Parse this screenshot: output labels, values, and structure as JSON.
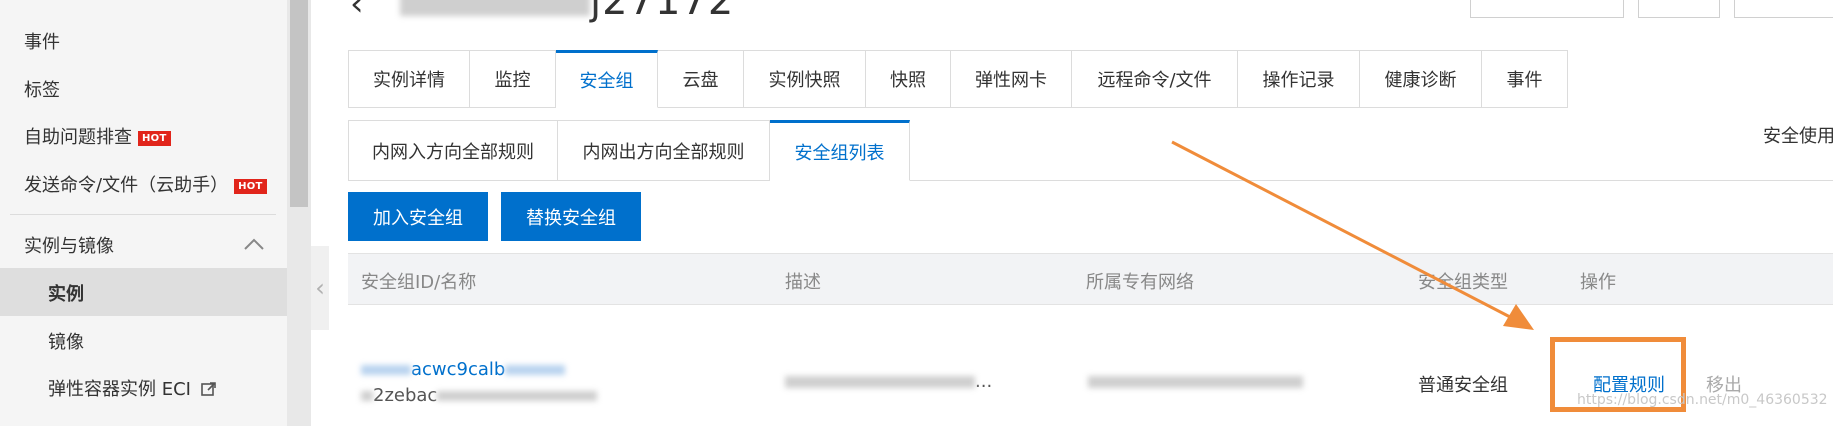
{
  "sidebar": {
    "items": [
      {
        "label": "事件"
      },
      {
        "label": "标签"
      },
      {
        "label": "自助问题排查",
        "badge": "HOT"
      },
      {
        "label": "发送命令/文件（云助手）",
        "badge": "HOT"
      }
    ],
    "section": {
      "label": "实例与镜像"
    },
    "sub_items": [
      {
        "label": "实例",
        "active": true
      },
      {
        "label": "镜像"
      },
      {
        "label": "弹性容器实例 ECI"
      }
    ]
  },
  "header": {
    "title_suffix": "j27172"
  },
  "tabs": [
    {
      "label": "实例详情"
    },
    {
      "label": "监控"
    },
    {
      "label": "安全组",
      "active": true
    },
    {
      "label": "云盘"
    },
    {
      "label": "实例快照"
    },
    {
      "label": "快照"
    },
    {
      "label": "弹性网卡"
    },
    {
      "label": "远程命令/文件"
    },
    {
      "label": "操作记录"
    },
    {
      "label": "健康诊断"
    },
    {
      "label": "事件"
    }
  ],
  "subtabs": [
    {
      "label": "内网入方向全部规则"
    },
    {
      "label": "内网出方向全部规则"
    },
    {
      "label": "安全组列表",
      "active": true
    }
  ],
  "right_note": "安全使用",
  "actions": {
    "join": "加入安全组",
    "replace": "替换安全组"
  },
  "table": {
    "columns": [
      "安全组ID/名称",
      "描述",
      "所属专有网络",
      "安全组类型",
      "操作"
    ],
    "rows": [
      {
        "id_visible": "acwc9calb",
        "name_visible": "2zebac",
        "desc_visible": "...",
        "type": "普通安全组",
        "op_config": "配置规则",
        "op_remove": "移出"
      }
    ]
  },
  "watermark": "https://blog.csdn.net/m0_46360532",
  "colors": {
    "accent": "#0070cc",
    "annotation": "#f08c3a",
    "hot": "#e1251b"
  }
}
